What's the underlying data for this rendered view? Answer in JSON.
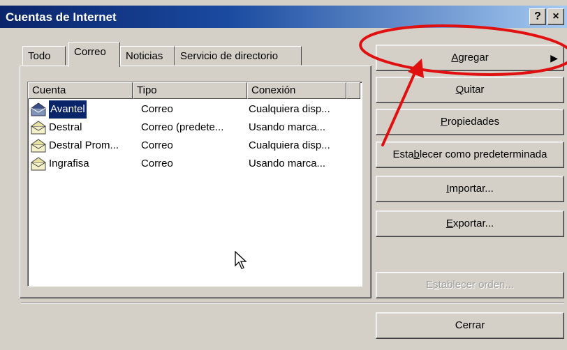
{
  "window": {
    "title": "Cuentas de Internet",
    "help_glyph": "?",
    "close_glyph": "×"
  },
  "tabs": [
    {
      "label": "Todo",
      "active": false
    },
    {
      "label": "Correo",
      "active": true
    },
    {
      "label": "Noticias",
      "active": false
    },
    {
      "label": "Servicio de directorio",
      "active": false
    }
  ],
  "list": {
    "columns": [
      "Cuenta",
      "Tipo",
      "Conexión"
    ],
    "rows": [
      {
        "cuenta": "Avantel",
        "tipo": "Correo",
        "conexion": "Cualquiera disp...",
        "selected": true,
        "icon": "mail-account-icon"
      },
      {
        "cuenta": "Destral",
        "tipo": "Correo (predete...",
        "conexion": "Usando marca...",
        "selected": false,
        "icon": "mail-account-icon"
      },
      {
        "cuenta": "Destral Prom...",
        "tipo": "Correo",
        "conexion": "Cualquiera disp...",
        "selected": false,
        "icon": "mail-account-icon"
      },
      {
        "cuenta": "Ingrafisa",
        "tipo": "Correo",
        "conexion": "Usando marca...",
        "selected": false,
        "icon": "mail-account-icon"
      }
    ]
  },
  "buttons": {
    "agregar": {
      "pre": "",
      "key": "A",
      "post": "gregar",
      "arrow": "▶"
    },
    "quitar": {
      "pre": "",
      "key": "Q",
      "post": "uitar"
    },
    "propiedades": {
      "pre": "",
      "key": "P",
      "post": "ropiedades"
    },
    "predeterminada": {
      "pre": "Esta",
      "key": "b",
      "post": "lecer como predeterminada"
    },
    "importar": {
      "pre": "",
      "key": "I",
      "post": "mportar..."
    },
    "exportar": {
      "pre": "",
      "key": "E",
      "post": "xportar..."
    },
    "orden": {
      "pre": "E",
      "key": "s",
      "post": "tablecer orden...",
      "disabled": true
    },
    "cerrar": {
      "label": "Cerrar"
    }
  },
  "annotation": {
    "color": "#e01010"
  },
  "colors": {
    "titlebar_start": "#0a246a",
    "titlebar_end": "#a6caf0",
    "face": "#d4d0c8",
    "selection": "#0a246a"
  }
}
